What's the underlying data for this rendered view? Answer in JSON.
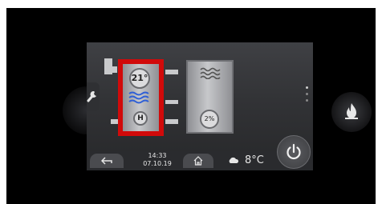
{
  "hot_water": {
    "temperature": "21°",
    "heater_label": "H"
  },
  "buffer_tank": {
    "level": "2%"
  },
  "status_bar": {
    "time": "14:33",
    "date": "07.10.19",
    "outside_temperature": "8°C",
    "weather_icon": "cloud-icon"
  },
  "side_controls": {
    "left_icon": "wrench-icon",
    "right_icon": "flame-icon"
  },
  "pager": {
    "dots": 3
  },
  "colors": {
    "selection": "#d10a0a",
    "water_waves": "#2f5fd6"
  }
}
